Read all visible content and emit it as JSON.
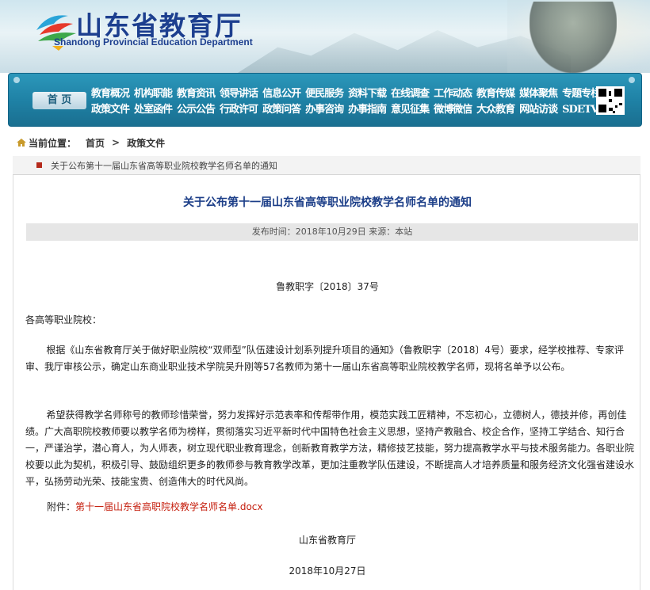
{
  "header": {
    "title": "山东省教育厅",
    "subtitle": "Shandong Provincial Education Department",
    "logo_icon": "shandong-edu-logo",
    "colors": {
      "brand": "#1d3f8f",
      "nav": "#1f82a6"
    }
  },
  "nav": {
    "home_label": "首 页",
    "row1": [
      "教育概况",
      "机构职能",
      "教育资讯",
      "领导讲话",
      "信息公开",
      "便民服务",
      "资料下载",
      "在线调查",
      "工作动态",
      "教育传媒",
      "媒体聚焦",
      "专题专栏"
    ],
    "row2": [
      "政策文件",
      "处室函件",
      "公示公告",
      "行政许可",
      "政策问答",
      "办事咨询",
      "办事指南",
      "意见征集",
      "微博微信",
      "大众教育",
      "网站访谈",
      "SDETV新闻"
    ],
    "qr_icon": "qr-code-icon"
  },
  "breadcrumb": {
    "label": "当前位置：",
    "home": "首页",
    "separator": ">",
    "current": "政策文件"
  },
  "subtab": {
    "label": "关于公布第十一届山东省高等职业院校教学名师名单的通知"
  },
  "article": {
    "title": "关于公布第十一届山东省高等职业院校教学名师名单的通知",
    "meta": "发布时间：2018年10月29日 来源：本站",
    "doc_number": "鲁教职字〔2018〕37号",
    "addressee": "各高等职业院校：",
    "paragraphs": [
      "根据《山东省教育厅关于做好职业院校“双师型”队伍建设计划系列提升项目的通知》（鲁教职字〔2018〕4号）要求，经学校推荐、专家评审、我厅审核公示，确定山东商业职业技术学院吴升刚等57名教师为第十一届山东省高等职业院校教学名师，现将名单予以公布。",
      "希望获得教学名师称号的教师珍惜荣誉，努力发挥好示范表率和传帮带作用，模范实践工匠精神，不忘初心，立德树人，德技并修，再创佳绩。广大高职院校教师要以教学名师为榜样，贯彻落实习近平新时代中国特色社会主义思想，坚持产教融合、校企合作，坚持工学结合、知行合一，严谨治学，潜心育人，为人师表，树立现代职业教育理念，创新教育教学方法，精修技艺技能，努力提高教学水平与技术服务能力。各职业院校要以此为契机，积极引导、鼓励组织更多的教师参与教育教学改革，更加注重教学队伍建设，不断提高人才培养质量和服务经济文化强省建设水平，弘扬劳动光荣、技能宝贵、创造伟大的时代风尚。"
    ],
    "attachment_label": "附件：",
    "attachment_link": "第十一届山东省高职院校教学名师名单.docx",
    "signature": "山东省教育厅",
    "date": "2018年10月27日"
  }
}
